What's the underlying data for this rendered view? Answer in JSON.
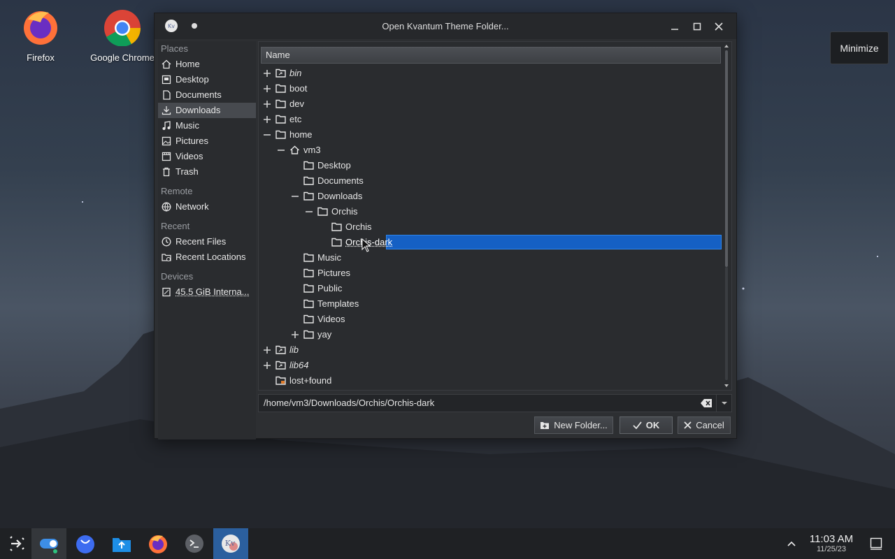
{
  "desktop": {
    "icons": [
      {
        "label": "Firefox"
      },
      {
        "label": "Google Chrome"
      }
    ],
    "tooltip": "Minimize"
  },
  "dialog": {
    "title": "Open Kvantum Theme Folder...",
    "sidebar": {
      "places_header": "Places",
      "places": [
        {
          "label": "Home",
          "icon": "home-icon"
        },
        {
          "label": "Desktop",
          "icon": "desktop-icon"
        },
        {
          "label": "Documents",
          "icon": "document-icon"
        },
        {
          "label": "Downloads",
          "icon": "download-icon"
        },
        {
          "label": "Music",
          "icon": "music-icon"
        },
        {
          "label": "Pictures",
          "icon": "picture-icon"
        },
        {
          "label": "Videos",
          "icon": "video-icon"
        },
        {
          "label": "Trash",
          "icon": "trash-icon"
        }
      ],
      "remote_header": "Remote",
      "remote": [
        {
          "label": "Network",
          "icon": "network-icon"
        }
      ],
      "recent_header": "Recent",
      "recent": [
        {
          "label": "Recent Files",
          "icon": "clock-icon"
        },
        {
          "label": "Recent Locations",
          "icon": "folder-clock-icon"
        }
      ],
      "devices_header": "Devices",
      "devices": [
        {
          "label": "45.5 GiB Interna...",
          "icon": "drive-icon"
        }
      ]
    },
    "column_header": "Name",
    "tree": [
      {
        "label": "bin",
        "italic": true
      },
      {
        "label": "boot"
      },
      {
        "label": "dev"
      },
      {
        "label": "etc"
      },
      {
        "label": "home"
      },
      {
        "label": "vm3"
      },
      {
        "label": "Desktop"
      },
      {
        "label": "Documents"
      },
      {
        "label": "Downloads"
      },
      {
        "label": "Orchis"
      },
      {
        "label": "Orchis"
      },
      {
        "label": "Orchis-dark"
      },
      {
        "label": "Music"
      },
      {
        "label": "Pictures"
      },
      {
        "label": "Public"
      },
      {
        "label": "Templates"
      },
      {
        "label": "Videos"
      },
      {
        "label": "yay"
      },
      {
        "label": "lib",
        "italic": true
      },
      {
        "label": "lib64",
        "italic": true
      },
      {
        "label": "lost+found"
      }
    ],
    "path_value": "/home/vm3/Downloads/Orchis/Orchis-dark",
    "buttons": {
      "new_folder": "New Folder...",
      "ok": "OK",
      "cancel": "Cancel"
    }
  },
  "taskbar": {
    "time": "11:03 AM",
    "date": "11/25/23"
  }
}
